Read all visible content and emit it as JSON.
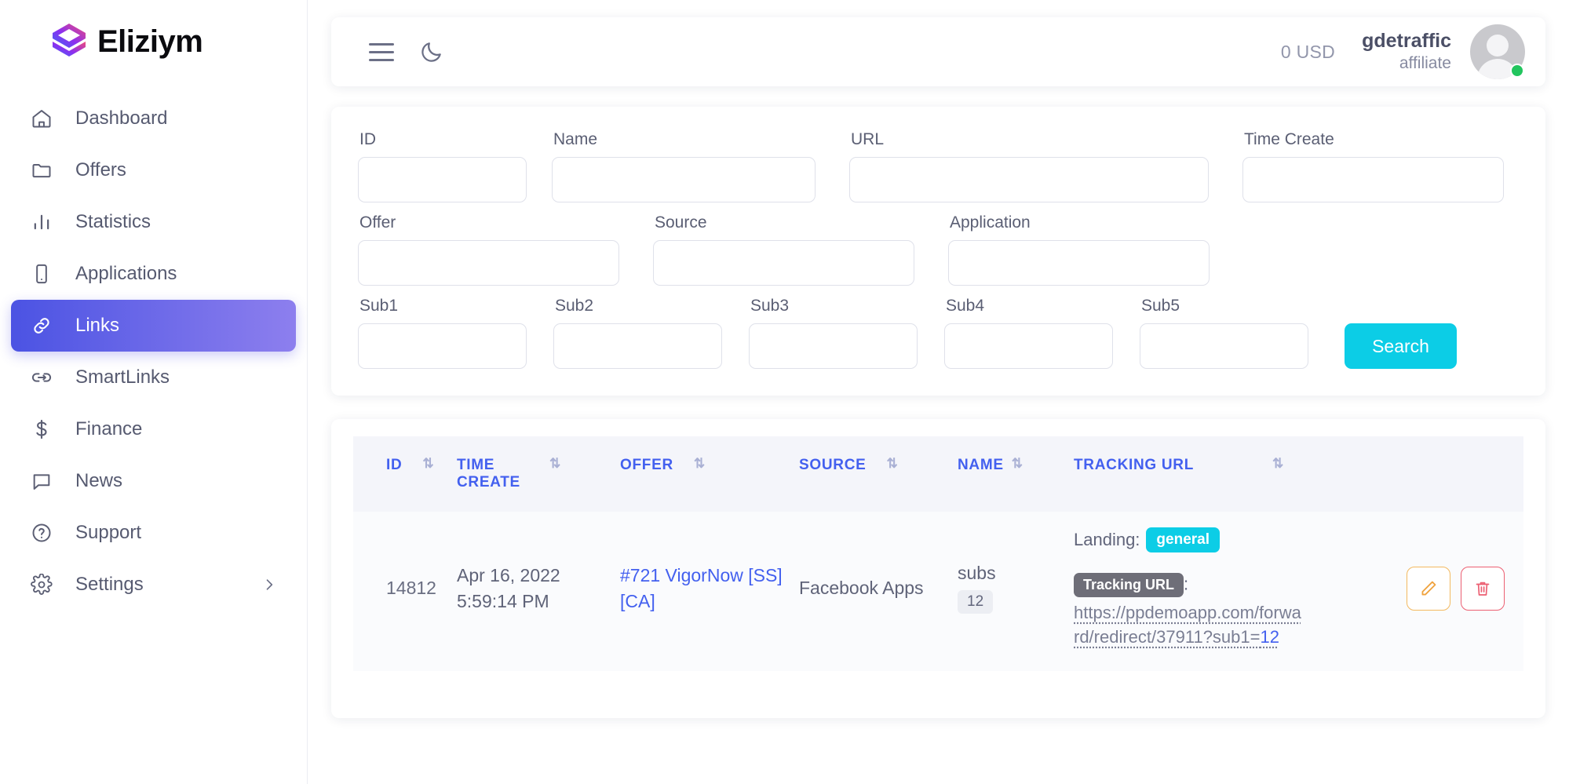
{
  "brand": {
    "name": "Eliziym",
    "logo_icon": "eliziym-logo-icon",
    "gradient_start": "#4f5fe8",
    "gradient_mid": "#9b3cf0",
    "gradient_end": "#ef4d7a"
  },
  "sidebar": {
    "items": [
      {
        "label": "Dashboard",
        "icon": "home-icon",
        "active": false
      },
      {
        "label": "Offers",
        "icon": "folder-icon",
        "active": false
      },
      {
        "label": "Statistics",
        "icon": "bar-chart-icon",
        "active": false
      },
      {
        "label": "Applications",
        "icon": "mobile-icon",
        "active": false
      },
      {
        "label": "Links",
        "icon": "link-icon",
        "active": true
      },
      {
        "label": "SmartLinks",
        "icon": "chain-link-icon",
        "active": false
      },
      {
        "label": "Finance",
        "icon": "dollar-icon",
        "active": false
      },
      {
        "label": "News",
        "icon": "chat-bubble-icon",
        "active": false
      },
      {
        "label": "Support",
        "icon": "help-circle-icon",
        "active": false
      },
      {
        "label": "Settings",
        "icon": "gear-icon",
        "active": false,
        "expandable": true
      }
    ],
    "active_accent": "#5855e6"
  },
  "header": {
    "menu_icon": "hamburger-menu-icon",
    "theme_icon": "moon-icon",
    "balance": "0 USD",
    "user_name": "gdetraffic",
    "user_role": "affiliate",
    "avatar_icon": "user-avatar-icon",
    "status_color": "#22c55e"
  },
  "filters": {
    "row1": [
      {
        "label": "ID",
        "value": "",
        "placeholder": ""
      },
      {
        "label": "Name",
        "value": "",
        "placeholder": ""
      },
      {
        "label": "URL",
        "value": "",
        "placeholder": ""
      },
      {
        "label": "Time Create",
        "value": "",
        "placeholder": ""
      }
    ],
    "row2": [
      {
        "label": "Offer",
        "value": "",
        "placeholder": ""
      },
      {
        "label": "Source",
        "value": "",
        "placeholder": ""
      },
      {
        "label": "Application",
        "value": "",
        "placeholder": ""
      }
    ],
    "row3": [
      {
        "label": "Sub1",
        "value": "",
        "placeholder": ""
      },
      {
        "label": "Sub2",
        "value": "",
        "placeholder": ""
      },
      {
        "label": "Sub3",
        "value": "",
        "placeholder": ""
      },
      {
        "label": "Sub4",
        "value": "",
        "placeholder": ""
      },
      {
        "label": "Sub5",
        "value": "",
        "placeholder": ""
      }
    ],
    "search_label": "Search",
    "search_color": "#0ccde6"
  },
  "table": {
    "sort_icon": "sort-updown-icon",
    "header_color": "#4360ef",
    "columns": [
      {
        "label": "ID",
        "sortable": true
      },
      {
        "label": "TIME CREATE",
        "sortable": true
      },
      {
        "label": "OFFER",
        "sortable": true
      },
      {
        "label": "SOURCE",
        "sortable": true
      },
      {
        "label": "NAME",
        "sortable": true
      },
      {
        "label": "TRACKING URL",
        "sortable": true
      },
      {
        "label": "",
        "sortable": false
      }
    ],
    "rows": [
      {
        "id": "14812",
        "time_create": "Apr 16, 2022 5:59:14 PM",
        "offer": "#721 VigorNow [SS] [CA]",
        "source": "Facebook Apps",
        "name": "subs",
        "name_count": "12",
        "landing_label": "Landing:",
        "landing_value": "general",
        "tracking_tip": "Tracking URL",
        "tracking_colon": ":",
        "tracking_url_base": "https://ppdemoapp.com/forward/redirect/37911?sub1=",
        "tracking_url_sub": "12",
        "edit_icon": "pencil-edit-icon",
        "delete_icon": "trash-delete-icon"
      }
    ]
  }
}
